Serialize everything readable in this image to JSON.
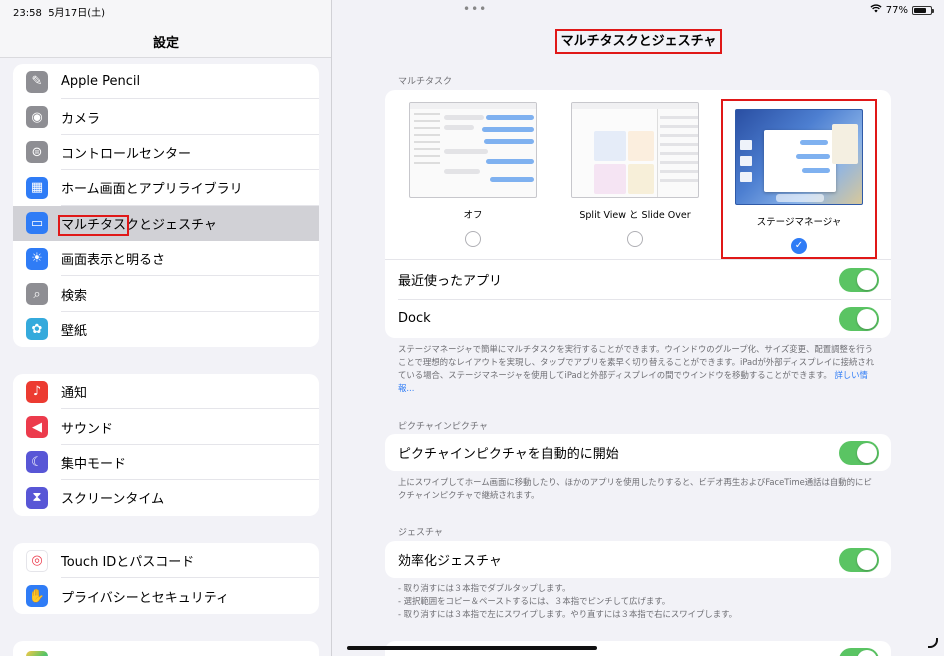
{
  "status": {
    "time": "23:58",
    "date": "5月17日(土)",
    "battery": "77%",
    "battery_fraction": 0.77
  },
  "sidebar": {
    "title": "設定",
    "group1": [
      {
        "label": "Apple Pencil",
        "icon": "pencil-icon",
        "color": "#8e8e93",
        "glyph": "✎"
      },
      {
        "label": "カメラ",
        "icon": "camera-icon",
        "color": "#8e8e93",
        "glyph": "◉"
      },
      {
        "label": "コントロールセンター",
        "icon": "toggles-icon",
        "color": "#8e8e93",
        "glyph": "⊜"
      },
      {
        "label": "ホーム画面とアプリライブラリ",
        "icon": "home-screen-icon",
        "color": "#2f7cf6",
        "glyph": "▦"
      },
      {
        "label": "マルチタスクとジェスチャ",
        "icon": "multitask-icon",
        "color": "#2f7cf6",
        "glyph": "▭",
        "selected": true
      },
      {
        "label": "画面表示と明るさ",
        "icon": "sun-icon",
        "color": "#2f7cf6",
        "glyph": "☀"
      },
      {
        "label": "検索",
        "icon": "search-icon",
        "color": "#8e8e93",
        "glyph": "⌕"
      },
      {
        "label": "壁紙",
        "icon": "wallpaper-icon",
        "color": "#35aadc",
        "glyph": "✿"
      }
    ],
    "group2": [
      {
        "label": "通知",
        "icon": "bell-icon",
        "color": "#ec3b31",
        "glyph": "♪"
      },
      {
        "label": "サウンド",
        "icon": "speaker-icon",
        "color": "#ec3b4c",
        "glyph": "◀"
      },
      {
        "label": "集中モード",
        "icon": "moon-icon",
        "color": "#5856d6",
        "glyph": "☾"
      },
      {
        "label": "スクリーンタイム",
        "icon": "hourglass-icon",
        "color": "#5856d6",
        "glyph": "⧗"
      }
    ],
    "group3": [
      {
        "label": "Touch IDとパスコード",
        "icon": "fingerprint-icon",
        "color": "#ffffff",
        "glyph": "◎"
      },
      {
        "label": "プライバシーとセキュリティ",
        "icon": "hand-icon",
        "color": "#2f7cf6",
        "glyph": "✋"
      }
    ]
  },
  "detail": {
    "title": "マルチタスクとジェスチャ",
    "multitask_section": "マルチタスク",
    "options": [
      {
        "label": "オフ",
        "selected": false
      },
      {
        "label": "Split View と Slide Over",
        "selected": false
      },
      {
        "label": "ステージマネージャ",
        "selected": true
      }
    ],
    "recent_apps": "最近使ったアプリ",
    "dock": "Dock",
    "stage_note": "ステージマネージャで簡単にマルチタスクを実行することができます。ウインドウのグループ化、サイズ変更、配置調整を行うことで理想的なレイアウトを実現し、タップでアプリを素早く切り替えることができます。iPadが外部ディスプレイに接続されている場合、ステージマネージャを使用してiPadと外部ディスプレイの間でウインドウを移動することができます。",
    "learn_more": "詳しい情報...",
    "pip_section": "ピクチャインピクチャ",
    "pip_auto": "ピクチャインピクチャを自動的に開始",
    "pip_note": "上にスワイプしてホーム画面に移動したり、ほかのアプリを使用したりすると、ビデオ再生およびFaceTime通話は自動的にピクチャインピクチャで継続されます。",
    "gesture_section": "ジェスチャ",
    "efficient_gestures": "効率化ジェスチャ",
    "gesture_notes": [
      "- 取り消すには３本指でダブルタップします。",
      "- 選択範囲をコピー＆ペーストするには、３本指でピンチして広げます。",
      "- 取り消すには３本指で左にスワイプします。やり直すには３本指で右にスワイプします。"
    ]
  },
  "colors": {
    "accent": "#2f7cf6",
    "toggle_on": "#5ac463",
    "highlight": "#e01818"
  }
}
